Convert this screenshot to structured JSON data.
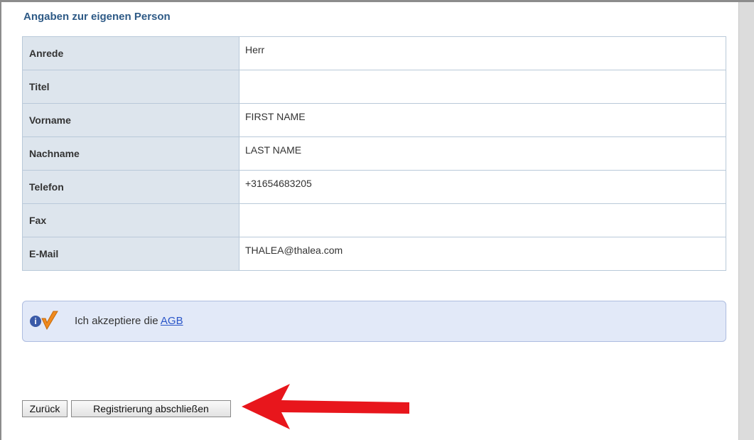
{
  "section": {
    "title": "Angaben zur eigenen Person"
  },
  "rows": [
    {
      "label": "Anrede",
      "value": "Herr"
    },
    {
      "label": "Titel",
      "value": ""
    },
    {
      "label": "Vorname",
      "value": "FIRST NAME"
    },
    {
      "label": "Nachname",
      "value": "LAST NAME"
    },
    {
      "label": "Telefon",
      "value": "+31654683205"
    },
    {
      "label": "Fax",
      "value": ""
    },
    {
      "label": "E-Mail",
      "value": "THALEA@thalea.com"
    }
  ],
  "notice": {
    "icon": "info-check-icon",
    "text": "Ich akzeptiere die",
    "link": "AGB",
    "info_glyph": "i"
  },
  "buttons": {
    "back": "Zurück",
    "submit": "Registrierung abschließen"
  },
  "colors": {
    "arrow": "#e8161c",
    "title": "#2e5a86",
    "check": "#f08a1e"
  }
}
